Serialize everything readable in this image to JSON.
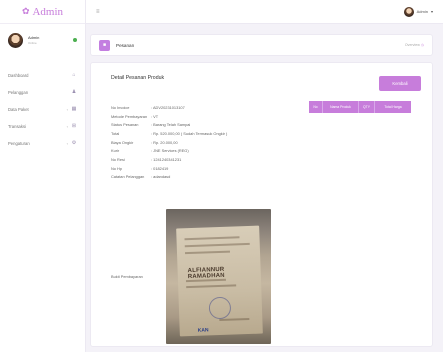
{
  "sidebar": {
    "brand": "Admin",
    "profile": {
      "name": "Admin",
      "role": "Online"
    },
    "items": [
      {
        "label": "Dashboard",
        "icon": "home-icon"
      },
      {
        "label": "Pelanggan",
        "icon": "users-icon"
      },
      {
        "label": "Data Paket",
        "icon": "grid-icon"
      },
      {
        "label": "Transaksi",
        "icon": "cart-icon"
      },
      {
        "label": "Pengaturan",
        "icon": "gear-icon"
      }
    ]
  },
  "topbar": {
    "user": "Admin"
  },
  "page": {
    "title": "Pesanan",
    "breadcrumb": "Overview"
  },
  "card": {
    "title": "Detail Pesanan Produk",
    "back_label": "Kembali",
    "details": [
      {
        "key": "No Invoice",
        "value": ": ADV20231013107"
      },
      {
        "key": "Metode Pembayaran",
        "value": ": VT"
      },
      {
        "key": "Status Pesanan",
        "value": ": Barang Telah Sampai"
      },
      {
        "key": "Total",
        "value": ": Rp. 520.000,00 ( Sudah Termasuk Ongkir )"
      },
      {
        "key": "Biaya Ongkir",
        "value": ": Rp. 20.000,00"
      },
      {
        "key": "Kurir",
        "value": ": JNE Services (REG)"
      },
      {
        "key": "No Resi",
        "value": ": 1241240341231"
      },
      {
        "key": "No Hp",
        "value": ": 0182419"
      },
      {
        "key": "Catatan Pelanggan",
        "value": ": adandasd"
      }
    ],
    "table_headers": [
      "No",
      "Nama Produk",
      "QTY",
      "Total Harga"
    ],
    "proof_label": "Bukti Pembayaran",
    "proof_name_text": "ALFIANNUR RAMADHAN",
    "proof_logo_text": "KAN"
  }
}
